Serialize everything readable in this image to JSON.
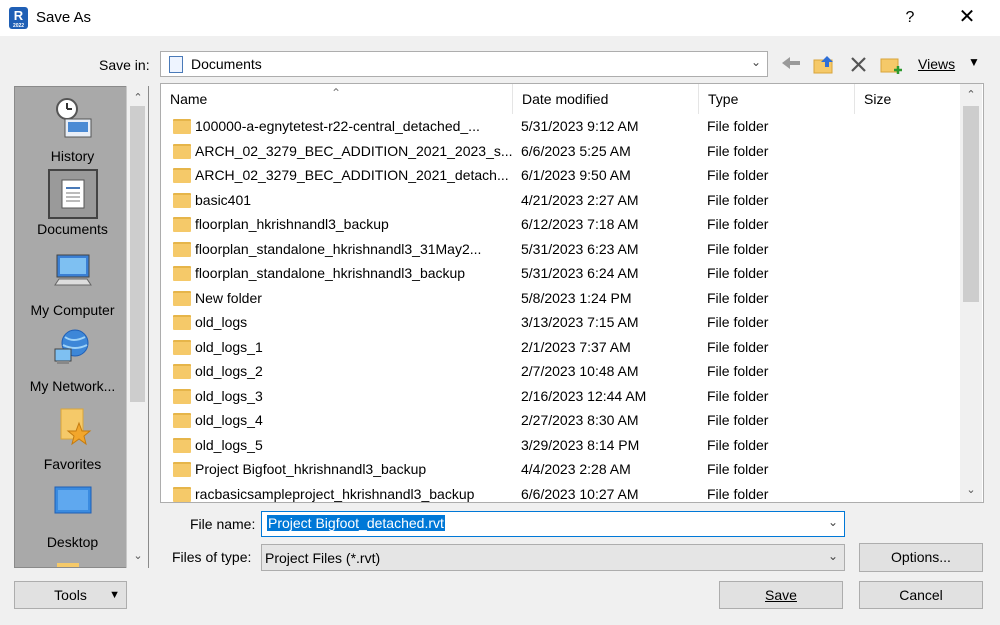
{
  "window": {
    "title": "Save As",
    "app_icon": "R",
    "app_icon_sub": "2022",
    "help_label": "?",
    "close_label": "✕"
  },
  "toolbar": {
    "save_in_label": "Save in:",
    "save_in_value": "Documents",
    "views_label": "Views"
  },
  "places": [
    {
      "label": "History",
      "icon": "history-icon"
    },
    {
      "label": "Documents",
      "icon": "documents-icon",
      "selected": true
    },
    {
      "label": "My Computer",
      "icon": "computer-icon"
    },
    {
      "label": "My Network...",
      "icon": "network-icon"
    },
    {
      "label": "Favorites",
      "icon": "favorites-icon"
    },
    {
      "label": "Desktop",
      "icon": "desktop-icon"
    }
  ],
  "columns": {
    "name": "Name",
    "date": "Date modified",
    "type": "Type",
    "size": "Size"
  },
  "files": [
    {
      "name": "100000-a-egnytetest-r22-central_detached_...",
      "date": "5/31/2023 9:12 AM",
      "type": "File folder"
    },
    {
      "name": "ARCH_02_3279_BEC_ADDITION_2021_2023_s...",
      "date": "6/6/2023 5:25 AM",
      "type": "File folder"
    },
    {
      "name": "ARCH_02_3279_BEC_ADDITION_2021_detach...",
      "date": "6/1/2023 9:50 AM",
      "type": "File folder"
    },
    {
      "name": "basic401",
      "date": "4/21/2023 2:27 AM",
      "type": "File folder"
    },
    {
      "name": "floorplan_hkrishnandl3_backup",
      "date": "6/12/2023 7:18 AM",
      "type": "File folder"
    },
    {
      "name": "floorplan_standalone_hkrishnandl3_31May2...",
      "date": "5/31/2023 6:23 AM",
      "type": "File folder"
    },
    {
      "name": "floorplan_standalone_hkrishnandl3_backup",
      "date": "5/31/2023 6:24 AM",
      "type": "File folder"
    },
    {
      "name": "New folder",
      "date": "5/8/2023 1:24 PM",
      "type": "File folder"
    },
    {
      "name": "old_logs",
      "date": "3/13/2023 7:15 AM",
      "type": "File folder"
    },
    {
      "name": "old_logs_1",
      "date": "2/1/2023 7:37 AM",
      "type": "File folder"
    },
    {
      "name": "old_logs_2",
      "date": "2/7/2023 10:48 AM",
      "type": "File folder"
    },
    {
      "name": "old_logs_3",
      "date": "2/16/2023 12:44 AM",
      "type": "File folder"
    },
    {
      "name": "old_logs_4",
      "date": "2/27/2023 8:30 AM",
      "type": "File folder"
    },
    {
      "name": "old_logs_5",
      "date": "3/29/2023 8:14 PM",
      "type": "File folder"
    },
    {
      "name": "Project Bigfoot_hkrishnandl3_backup",
      "date": "4/4/2023 2:28 AM",
      "type": "File folder"
    },
    {
      "name": "racbasicsampleproject_hkrishnandl3_backup",
      "date": "6/6/2023 10:27 AM",
      "type": "File folder"
    }
  ],
  "form": {
    "file_name_label": "File name:",
    "file_name_value": "Project Bigfoot_detached.rvt",
    "file_type_label": "Files of type:",
    "file_type_value": "Project Files  (*.rvt)"
  },
  "buttons": {
    "options": "Options...",
    "tools": "Tools",
    "save": "Save",
    "cancel": "Cancel"
  }
}
